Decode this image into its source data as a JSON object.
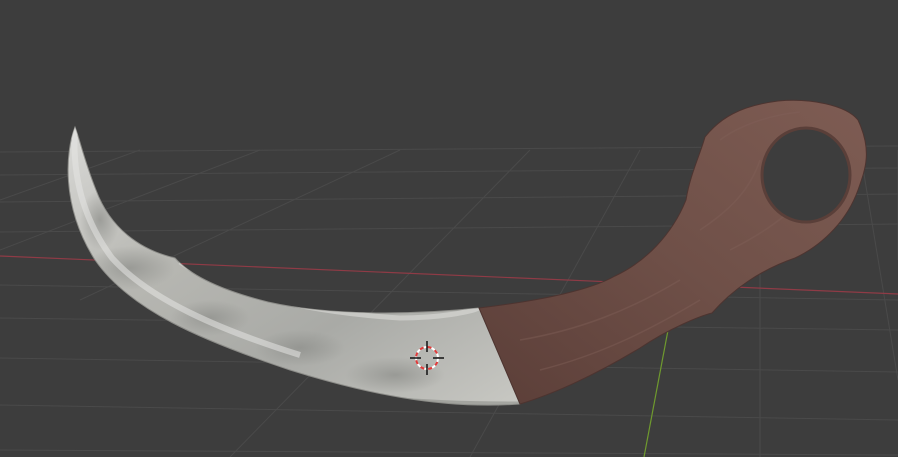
{
  "viewport": {
    "background_color": "#3d3d3d",
    "grid_color": "#4a4a4a",
    "x_axis_color": "#8f3b46",
    "y_axis_color": "#6f9a2e"
  },
  "scene": {
    "object": "karambit-knife",
    "blade_color": "#b8b8b3",
    "handle_color": "#6a4c45",
    "cursor_icon": "3d-cursor-icon"
  }
}
